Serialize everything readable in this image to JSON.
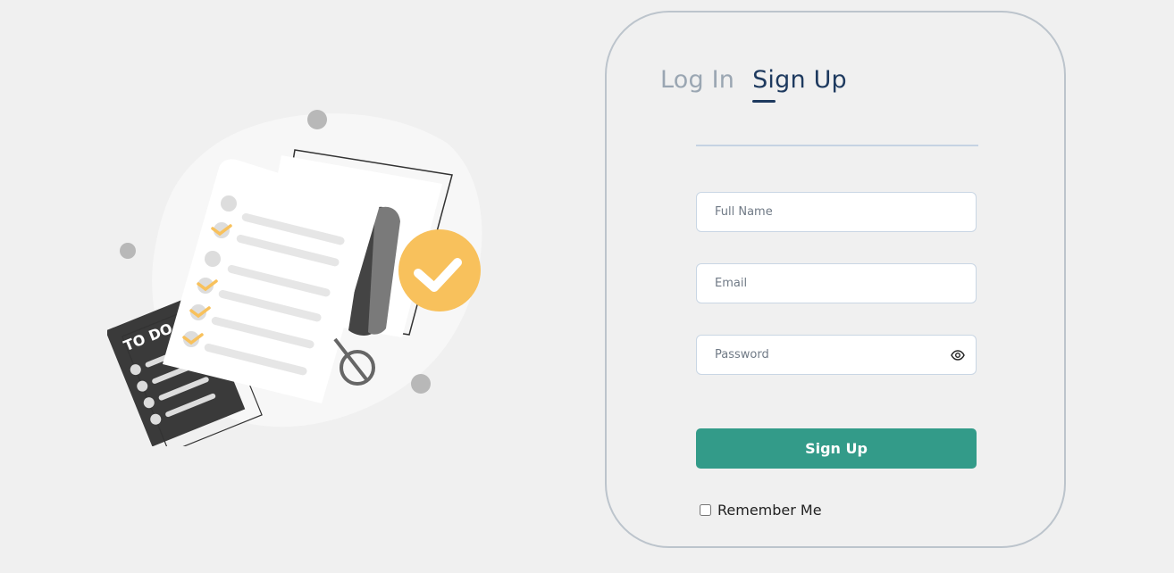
{
  "tabs": {
    "login_label": "Log In",
    "signup_label": "Sign Up",
    "active": "signup"
  },
  "form": {
    "full_name": {
      "placeholder": "Full Name",
      "value": ""
    },
    "email": {
      "placeholder": "Email",
      "value": ""
    },
    "password": {
      "placeholder": "Password",
      "value": ""
    },
    "password_toggle_icon": "eye-icon",
    "submit_label": "Sign Up",
    "remember_label": "Remember Me",
    "remember_checked": false
  },
  "illustration": {
    "badge_text": "TO DO"
  },
  "colors": {
    "background": "#f0f0f0",
    "accent": "#339b89",
    "active_tab": "#1e3a5f",
    "inactive_tab": "#9aa6b2",
    "check_orange": "#f8c15c"
  }
}
